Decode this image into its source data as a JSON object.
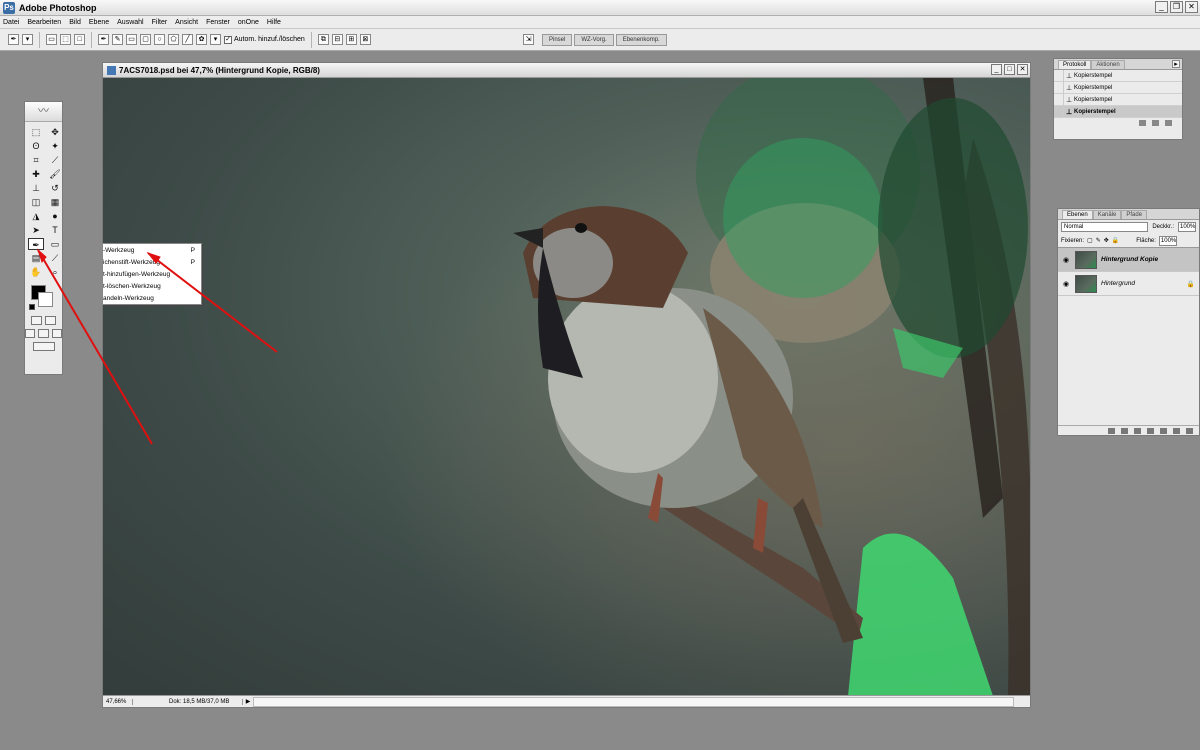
{
  "window": {
    "title": "Adobe Photoshop",
    "app_icon": "Ps"
  },
  "menus": [
    "Datei",
    "Bearbeiten",
    "Bild",
    "Ebene",
    "Auswahl",
    "Filter",
    "Ansicht",
    "Fenster",
    "onOne",
    "Hilfe"
  ],
  "options": {
    "auto_add_label": "Autom. hinzuf./löschen",
    "auto_add_checked": "✓"
  },
  "palette_well": [
    "Pinsel",
    "WZ-Vorg.",
    "Ebenenkomp."
  ],
  "flyout": {
    "items": [
      {
        "label": "-Werkzeug",
        "key": "P"
      },
      {
        "label": "ichenstift-Werkzeug",
        "key": "P"
      },
      {
        "label": "t-hinzufügen-Werkzeug",
        "key": ""
      },
      {
        "label": "t-löschen-Werkzeug",
        "key": ""
      },
      {
        "label": "andeln-Werkzeug",
        "key": ""
      }
    ]
  },
  "document": {
    "title": "7ACS7018.psd bei 47,7% (Hintergrund Kopie, RGB/8)",
    "zoom": "47,66%",
    "docsize": "Dok: 18,5 MB/37,0 MB",
    "status_arrow": "▶"
  },
  "history_panel": {
    "tabs": [
      "Protokoll",
      "Aktionen"
    ],
    "rows": [
      {
        "label": "Kopierstempel",
        "selected": false
      },
      {
        "label": "Kopierstempel",
        "selected": false
      },
      {
        "label": "Kopierstempel",
        "selected": false
      },
      {
        "label": "Kopierstempel",
        "selected": true
      }
    ]
  },
  "layers_panel": {
    "tabs": [
      "Ebenen",
      "Kanäle",
      "Pfade"
    ],
    "blend_mode": "Normal",
    "opacity_label": "Deckkr.:",
    "opacity_value": "100%",
    "lock_label": "Fixieren:",
    "fill_label": "Fläche:",
    "fill_value": "100%",
    "layers": [
      {
        "name": "Hintergrund Kopie",
        "selected": true
      },
      {
        "name": "Hintergrund",
        "selected": false
      }
    ]
  },
  "colors": {
    "arrow": "#e01010",
    "foreground": "#000000",
    "background": "#ffffff"
  }
}
